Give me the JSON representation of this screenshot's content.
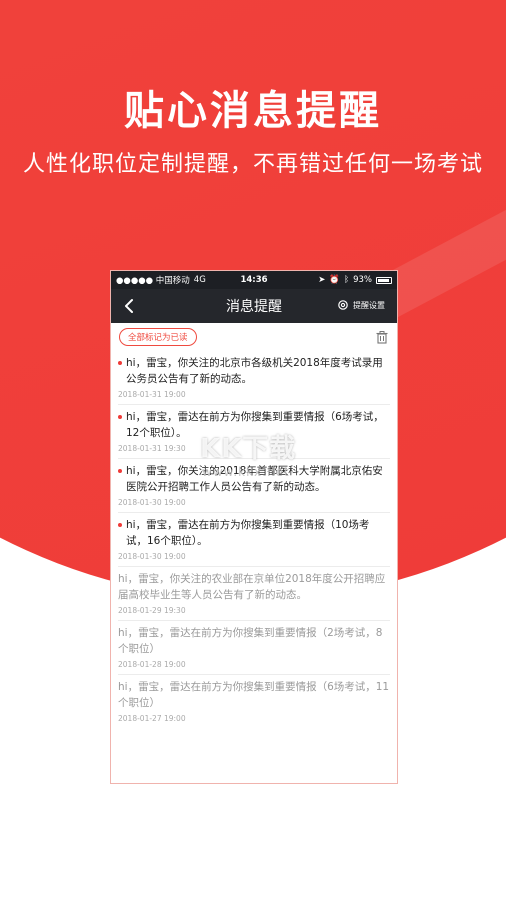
{
  "hero": {
    "headline": "贴心消息提醒",
    "subline": "人性化职位定制提醒，不再错过任何一场考试"
  },
  "statusbar": {
    "carrier": "●●●●● 中国移动",
    "network": "4G",
    "time": "14:36",
    "battery_text": "93%",
    "battery_level": 0.93
  },
  "navbar": {
    "back_icon": "chevron-left-icon",
    "title": "消息提醒",
    "settings_label": "提醒设置"
  },
  "toolbar": {
    "mark_all_read": "全部标记为已读"
  },
  "messages": [
    {
      "text": "hi，雷宝，你关注的北京市各级机关2018年度考试录用公务员公告有了新的动态。",
      "date": "2018-01-31 19:00",
      "unread": true
    },
    {
      "text": "hi，雷宝，雷达在前方为你搜集到重要情报（6场考试，12个职位）。",
      "date": "2018-01-31 19:30",
      "unread": true
    },
    {
      "text": "hi，雷宝，你关注的2018年首都医科大学附属北京佑安医院公开招聘工作人员公告有了新的动态。",
      "date": "2018-01-30 19:00",
      "unread": true
    },
    {
      "text": "hi，雷宝，雷达在前方为你搜集到重要情报（10场考试，16个职位）。",
      "date": "2018-01-30 19:00",
      "unread": true
    },
    {
      "text": "hi，雷宝，你关注的农业部在京单位2018年度公开招聘应届高校毕业生等人员公告有了新的动态。",
      "date": "2018-01-29 19:30",
      "unread": false
    },
    {
      "text": "hi，雷宝，雷达在前方为你搜集到重要情报（2场考试，8个职位）",
      "date": "2018-01-28 19:00",
      "unread": false
    },
    {
      "text": "hi，雷宝，雷达在前方为你搜集到重要情报（6场考试，11个职位）",
      "date": "2018-01-27 19:00",
      "unread": false
    }
  ],
  "watermark": {
    "logo": "KK下载",
    "url": "www.kkx.net"
  },
  "colors": {
    "brand_red": "#ef3b38",
    "navbar": "#25272c"
  }
}
